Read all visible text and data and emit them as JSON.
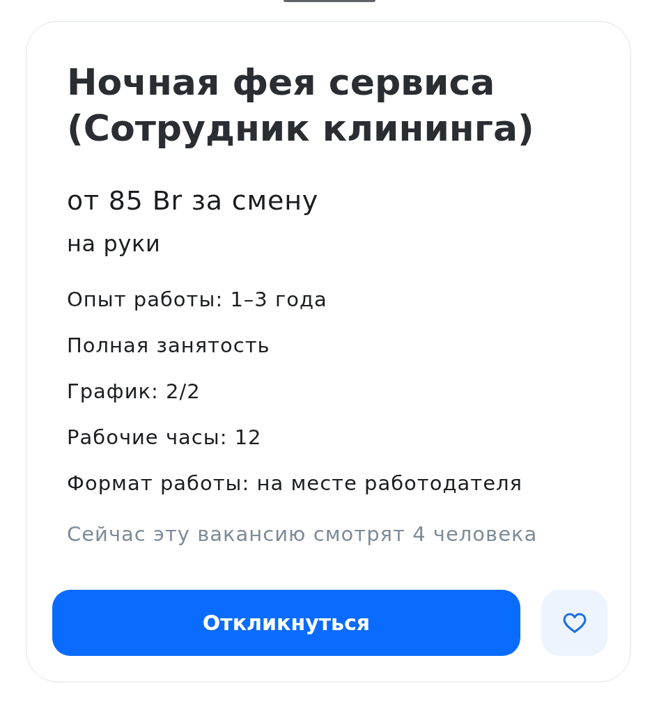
{
  "title": "Ночная фея сервиса (Сотрудник клининга)",
  "salary": {
    "amount": "от 85 Br за смену",
    "note": "на руки"
  },
  "details": [
    "Опыт работы: 1–3 года",
    "Полная занятость",
    "График: 2/2",
    "Рабочие часы: 12",
    "Формат работы: на месте работодателя"
  ],
  "viewers_note": "Сейчас эту вакансию смотрят 4 человека",
  "actions": {
    "apply_button": "Откликнуться",
    "favorite": {
      "selected": false
    }
  }
}
